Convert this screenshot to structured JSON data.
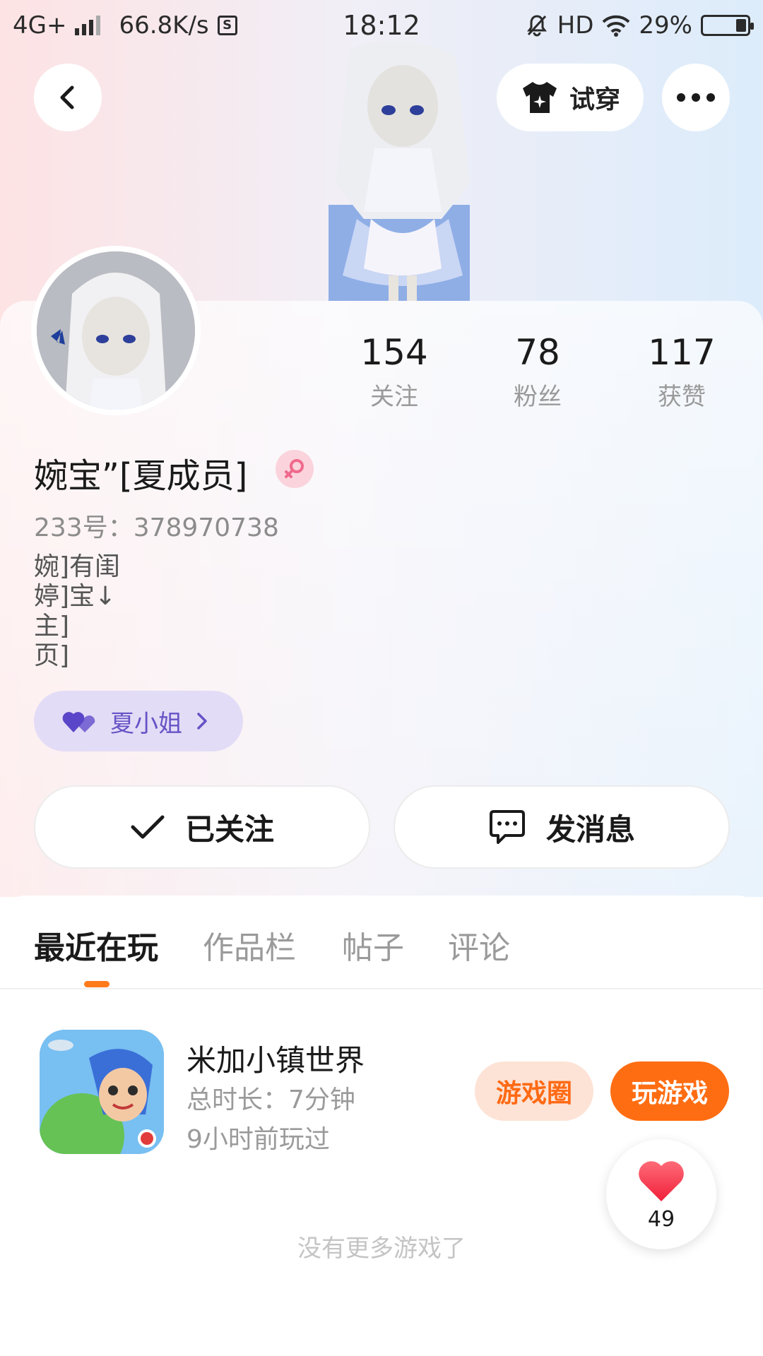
{
  "status_bar": {
    "network": "4G+",
    "speed": "66.8K/s",
    "s_icon_label": "S",
    "time": "18:12",
    "hd": "HD",
    "battery": "29%"
  },
  "header": {
    "try_on_label": "试穿"
  },
  "profile": {
    "stats": [
      {
        "value": "154",
        "label": "关注"
      },
      {
        "value": "78",
        "label": "粉丝"
      },
      {
        "value": "117",
        "label": "获赞"
      }
    ],
    "username": "婉宝”[夏成员]",
    "uid": "233号：378970738",
    "bio": [
      "婉]有闺",
      "婷]宝↓",
      "主]",
      "页]"
    ],
    "tag": "夏小姐",
    "follow_label": "已关注",
    "message_label": "发消息"
  },
  "tabs": [
    "最近在玩",
    "作品栏",
    "帖子",
    "评论"
  ],
  "game": {
    "name": "米加小镇世界",
    "duration": "总时长：7分钟",
    "last_played": "9小时前玩过",
    "circle_label": "游戏圈",
    "play_label": "玩游戏"
  },
  "like_count": "49",
  "no_more_text": "没有更多游戏了",
  "colors": {
    "accent": "#ff6d12",
    "tag_bg": "#e3dcf6",
    "tag_text": "#6653c6",
    "gender_bg": "#fbd3dc"
  }
}
